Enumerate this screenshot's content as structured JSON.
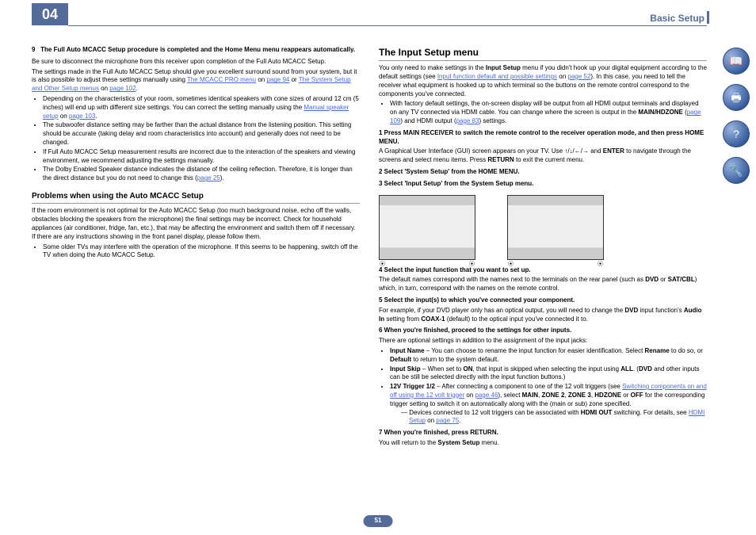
{
  "header": {
    "chapter": "04",
    "title": "Basic Setup"
  },
  "pageNum": "51",
  "left": {
    "lead_num": "9",
    "lead": "The Full Auto MCACC Setup procedure is completed and the Home Menu menu reappears automatically.",
    "p1a": "Be sure to disconnect the microphone from this receiver upon completion of the Full Auto MCACC Setup.",
    "p1b": "The settings made in the Full Auto MCACC Setup should give you excellent surround sound from your system, but it is also possible to adjust these settings manually using ",
    "link1": "The MCACC PRO menu",
    "link1_after": " on ",
    "link1_page": "page 94",
    "link1_or": " or ",
    "link2": "The System Setup and Other Setup menus",
    "link2_on": " on ",
    "link2_page": "page 102",
    "b1a": "Depending on the characteristics of your room, sometimes identical speakers with cone sizes of around 12 cm (5 inches) will end up with different size settings. You can correct the setting manually using the ",
    "b1link": "Manual speaker setup",
    "b1on": " on ",
    "b1page": "page 103",
    "b2": "The subwoofer distance setting may be farther than the actual distance from the listening position. This setting should be accurate (taking delay and room characteristics into account) and generally does not need to be changed.",
    "b3": "If Full Auto MCACC Setup measurement results are incorrect due to the interaction of the speakers and viewing environment, we recommend adjusting the settings manually.",
    "b4a": "The Dolby Enabled Speaker distance indicates the distance of the ceiling reflection. Therefore, it is longer than the direct distance but you do not need to change this (",
    "b4link": "page 25",
    "b4b": ").",
    "h2": "Problems when using the Auto MCACC Setup",
    "p2": "If the room environment is not optimal for the Auto MCACC Setup (too much background noise, echo off the walls, obstacles blocking the speakers from the microphone) the final settings may be incorrect. Check for household appliances (air conditioner, fridge, fan, etc.), that may be affecting the environment and switch them off if necessary. If there are any instructions showing in the front panel display, please follow them.",
    "b5": "Some older TVs may interfere with the operation of the microphone. If this seems to be happening, switch off the TV when doing the Auto MCACC Setup."
  },
  "right": {
    "h1": "The Input Setup menu",
    "p1a": "You only need to make settings in the ",
    "p1b": "Input Setup",
    "p1c": " menu if you didn't hook up your digital equipment according to the default settings (see ",
    "link1": "Input function default and possible settings",
    "link1_on": " on ",
    "link1_page": "page 52",
    "p1d": "). In this case, you need to tell the receiver what equipment is hooked up to which terminal so the buttons on the remote control correspond to the components you've connected.",
    "b1a": "With factory default settings, the on-screen display will be output from all HDMI output terminals and displayed on any TV connected via HDMI cable. You can change where the screen is output in the ",
    "b1b": "MAIN/HDZONE",
    "b1c": " (",
    "b1link": "page 109",
    "b1d": ") and HDMI output (",
    "b1link2": "page 83",
    "b1e": ") settings.",
    "s1a": "1   Press MAIN RECEIVER to switch the remote control to the receiver operation mode, and then press HOME MENU.",
    "s1b": "A Graphical User Interface (GUI) screen appears on your TV. Use ↑/↓/←/→ and ",
    "s1c": "ENTER",
    "s1d": " to navigate through the screens and select menu items. Press ",
    "s1e": "RETURN",
    "s1f": " to exit the current menu.",
    "s2": "2   Select 'System Setup' from the HOME MENU.",
    "s3": "3   Select 'Input Setup' from the System Setup menu.",
    "s4": "4   Select the input function that you want to set up.",
    "s4b": "The default names correspond with the names next to the terminals on the rear panel (such as ",
    "s4dvd": "DVD",
    "s4or": " or ",
    "s4sat": "SAT/CBL",
    "s4c": ") which, in turn, correspond with the names on the remote control.",
    "s5": "5   Select the input(s) to which you've connected your component.",
    "s5b": "For example, if your DVD player only has an optical output, you will need to change the ",
    "s5dvd": "DVD",
    "s5c": " input function's ",
    "s5ai": "Audio In",
    "s5d": " setting from ",
    "s5coax": "COAX-1",
    "s5e": " (default) to the optical input you've connected it to.",
    "s6": "6   When you're finished, proceed to the settings for other inputs.",
    "s6b": "There are optional settings in addition to the assignment of the input jacks:",
    "opt1a": "Input Name",
    "opt1b": " – You can choose to rename the input function for easier identification. Select ",
    "opt1c": "Rename",
    "opt1d": " to do so, or ",
    "opt1e": "Default",
    "opt1f": " to return to the system default.",
    "opt2a": "Input Skip",
    "opt2b": " – When set to ",
    "opt2c": "ON",
    "opt2d": ", that input is skipped when selecting the input using ",
    "opt2e": "ALL",
    "opt2f": ". (",
    "opt2g": "DVD",
    "opt2h": " and other inputs can be still be selected directly with the input function buttons.)",
    "opt3a": "12V Trigger 1/2",
    "opt3b": " – After connecting a component to one of the 12 volt triggers (see ",
    "opt3link": "Switching components on and off using the 12 volt trigger",
    "opt3on": " on ",
    "opt3page": "page 46",
    "opt3c": "), select ",
    "opt3d": "MAIN",
    "opt3e": ", ",
    "opt3f": "ZONE 2",
    "opt3g": ", ",
    "opt3h": "ZONE 3",
    "opt3i": ", ",
    "opt3j": "HDZONE",
    "opt3k": " or ",
    "opt3l": "OFF",
    "opt3m": " for the corresponding trigger setting to switch it on automatically along with the (main or sub) zone specified.",
    "opt3n": "— Devices connected to 12 volt triggers can be associated with ",
    "opt3o": "HDMI OUT",
    "opt3p": " switching. For details, see ",
    "opt3link2": "HDMI Setup",
    "opt3on2": " on ",
    "opt3page2": "page 75",
    "s7": "7   When you're finished, press RETURN.",
    "s7b": "You will return to the ",
    "s7c": "System Setup",
    "s7d": " menu."
  },
  "icons": [
    "book",
    "printer",
    "help",
    "tools"
  ]
}
